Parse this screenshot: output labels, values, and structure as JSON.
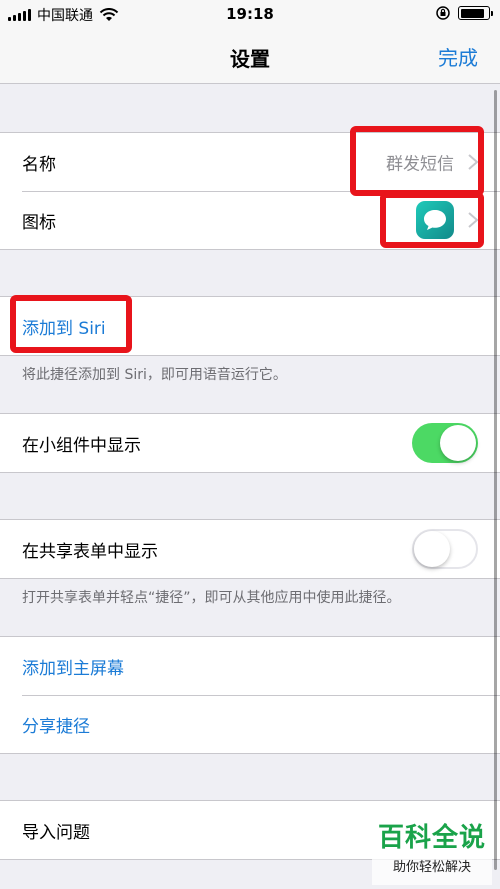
{
  "status_bar": {
    "carrier": "中国联通",
    "time": "19:18"
  },
  "nav": {
    "title": "设置",
    "done_label": "完成"
  },
  "section1": {
    "name_label": "名称",
    "name_value": "群发短信",
    "icon_label": "图标",
    "icon_glyph": "message-bubble-icon"
  },
  "section2": {
    "add_siri_label": "添加到 Siri",
    "note": "将此捷径添加到 Siri，即可用语音运行它。"
  },
  "section3": {
    "widget_label": "在小组件中显示",
    "widget_toggle_on": true
  },
  "section4": {
    "share_sheet_label": "在共享表单中显示",
    "share_sheet_toggle_on": false,
    "note": "打开共享表单并轻点“捷径”，即可从其他应用中使用此捷径。"
  },
  "section5": {
    "add_home_label": "添加到主屏幕",
    "share_shortcut_label": "分享捷径"
  },
  "section6": {
    "import_questions_label": "导入问题"
  },
  "watermark": {
    "title": "百科全说",
    "subtitle": "助你轻松解决"
  },
  "colors": {
    "accent": "#1b7bd6",
    "toggle_on": "#4cd964",
    "highlight": "#e8141b",
    "watermark_green": "#1aa34a"
  }
}
